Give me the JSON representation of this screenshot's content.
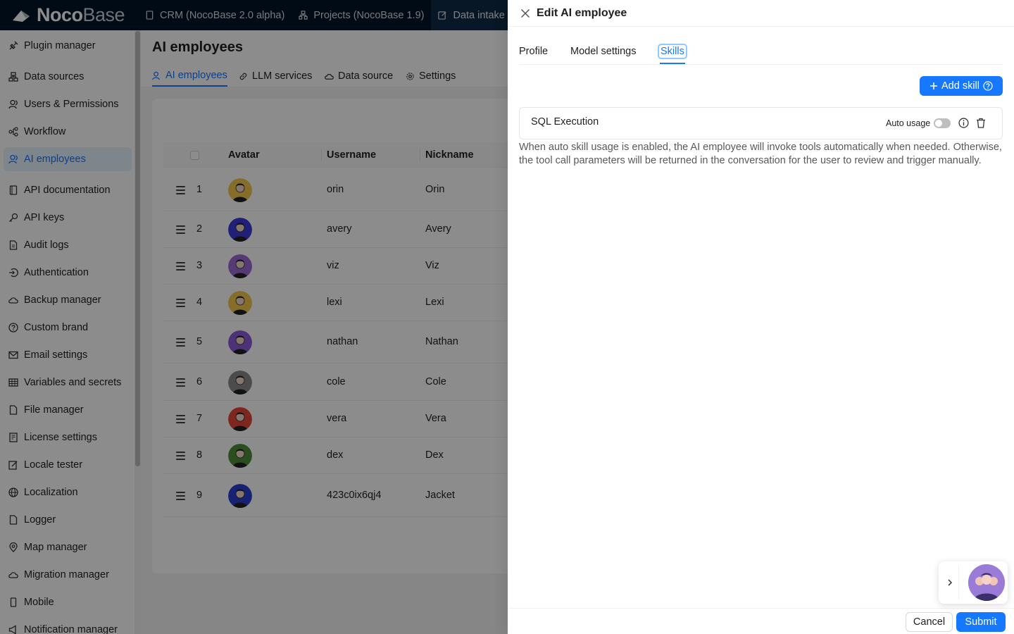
{
  "app": {
    "logo_bold": "Noco",
    "logo_thin": "Base",
    "top_tabs": [
      {
        "label": "CRM (NocoBase 2.0 alpha)"
      },
      {
        "label": "Projects (NocoBase 1.9)"
      },
      {
        "label": "Data intake"
      }
    ]
  },
  "sidebar": {
    "items": [
      {
        "label": "Plugin manager",
        "icon": "plug-icon"
      },
      {
        "label": "Data sources",
        "icon": "database-icon"
      },
      {
        "label": "Users & Permissions",
        "icon": "users-icon"
      },
      {
        "label": "Workflow",
        "icon": "workflow-icon"
      },
      {
        "label": "AI employees",
        "icon": "users-icon",
        "active": true
      },
      {
        "label": "API documentation",
        "icon": "book-icon"
      },
      {
        "label": "API keys",
        "icon": "key-icon"
      },
      {
        "label": "Audit logs",
        "icon": "file-icon"
      },
      {
        "label": "Authentication",
        "icon": "login-icon"
      },
      {
        "label": "Backup manager",
        "icon": "cloud-icon"
      },
      {
        "label": "Custom brand",
        "icon": "question-icon"
      },
      {
        "label": "Email settings",
        "icon": "mail-icon"
      },
      {
        "label": "Variables and secrets",
        "icon": "table-icon"
      },
      {
        "label": "File manager",
        "icon": "file-icon"
      },
      {
        "label": "License settings",
        "icon": "license-icon"
      },
      {
        "label": "Locale tester",
        "icon": "edit-icon"
      },
      {
        "label": "Localization",
        "icon": "globe-icon"
      },
      {
        "label": "Logger",
        "icon": "file-icon"
      },
      {
        "label": "Map manager",
        "icon": "pin-icon"
      },
      {
        "label": "Migration manager",
        "icon": "cloud-icon"
      },
      {
        "label": "Mobile",
        "icon": "mobile-icon"
      },
      {
        "label": "Notification manager",
        "icon": "sound-icon"
      }
    ]
  },
  "page": {
    "title": "AI employees",
    "tabs": [
      {
        "label": "AI employees",
        "active": true
      },
      {
        "label": "LLM services"
      },
      {
        "label": "Data source"
      },
      {
        "label": "Settings"
      }
    ],
    "columns": [
      "Avatar",
      "Username",
      "Nickname"
    ],
    "rows": [
      {
        "index": "1",
        "username": "orin",
        "nickname": "Orin",
        "color": "#f2c94c"
      },
      {
        "index": "2",
        "username": "avery",
        "nickname": "Avery",
        "color": "#3b3bdc"
      },
      {
        "index": "3",
        "username": "viz",
        "nickname": "Viz",
        "color": "#9b6ad6"
      },
      {
        "index": "4",
        "username": "lexi",
        "nickname": "Lexi",
        "color": "#f2c94c"
      },
      {
        "index": "5",
        "username": "nathan",
        "nickname": "Nathan",
        "color": "#8a5cd8"
      },
      {
        "index": "6",
        "username": "cole",
        "nickname": "Cole",
        "color": "#8a8a8a"
      },
      {
        "index": "7",
        "username": "vera",
        "nickname": "Vera",
        "color": "#e5483a"
      },
      {
        "index": "8",
        "username": "dex",
        "nickname": "Dex",
        "color": "#4f8f3a"
      },
      {
        "index": "9",
        "username": "423c0ix6qj4",
        "nickname": "Jacket",
        "color": "#2d3fd6"
      }
    ]
  },
  "drawer": {
    "title": "Edit AI employee",
    "tabs": [
      {
        "label": "Profile"
      },
      {
        "label": "Model settings"
      },
      {
        "label": "Skills",
        "active": true
      }
    ],
    "add_skill_label": "Add skill",
    "skill": {
      "name": "SQL Execution",
      "auto_usage_label": "Auto usage",
      "auto_usage_on": false
    },
    "help_text": "When auto skill usage is enabled, the AI employee will invoke tools automatically when needed. Otherwise, the tool call parameters will be returned in the conversation for the user to review and trigger manually.",
    "cancel_label": "Cancel",
    "submit_label": "Submit"
  },
  "colors": {
    "primary": "#1677ff",
    "topbar": "#001529"
  }
}
